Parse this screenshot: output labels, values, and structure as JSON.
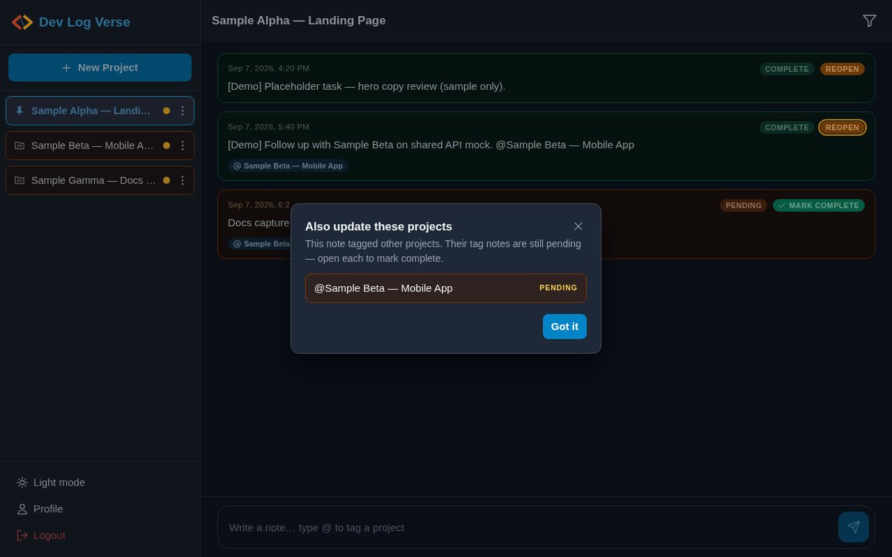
{
  "sidebar": {
    "brand": "Dev Log Verse",
    "new_project_button": "New Project",
    "projects": [
      {
        "name": "Sample Alpha — Landi…",
        "selected": true,
        "pinned": true
      },
      {
        "name": "Sample Beta — Mobile A…",
        "selected": false,
        "pinned": false
      },
      {
        "name": "Sample Gamma — Docs …",
        "selected": false,
        "pinned": false
      }
    ],
    "footer_items": [
      {
        "kind": "theme",
        "label": "Light mode"
      },
      {
        "kind": "profile",
        "label": "Profile"
      },
      {
        "kind": "logout",
        "label": "Logout"
      }
    ]
  },
  "header": {
    "title": "Sample Alpha — Landing Page"
  },
  "notes": [
    {
      "kind": "complete",
      "timestamp": "Sep 7, 2026, 4:20 PM",
      "text": "[Demo] Placeholder task — hero copy review (sample only).",
      "status_label": "COMPLETE",
      "action_label": "REOPEN",
      "action_focused": false
    },
    {
      "kind": "complete",
      "timestamp": "Sep 7, 2026, 5:40 PM",
      "text": "[Demo] Follow up with Sample Beta on shared API mock. @Sample Beta — Mobile App",
      "status_label": "COMPLETE",
      "action_label": "REOPEN",
      "action_focused": true,
      "tags": [
        "Sample Beta — Mobile App"
      ]
    },
    {
      "kind": "pending",
      "timestamp": "Sep 7, 2026, 6:2",
      "text": "Docs capture",
      "status_label": "PENDING",
      "action_label": "MARK COMPLETE",
      "action_focused": false,
      "tags": [
        "Sample Beta"
      ]
    }
  ],
  "dialog": {
    "title": "Also update these projects",
    "description": "This note tagged other projects. Their tag notes are still pending — open each to mark complete.",
    "projects": [
      {
        "name": "@Sample Beta — Mobile App",
        "status": "PENDING"
      }
    ],
    "confirm_button": "Got it"
  },
  "composer": {
    "placeholder": "Write a note… type @ to tag a project"
  }
}
